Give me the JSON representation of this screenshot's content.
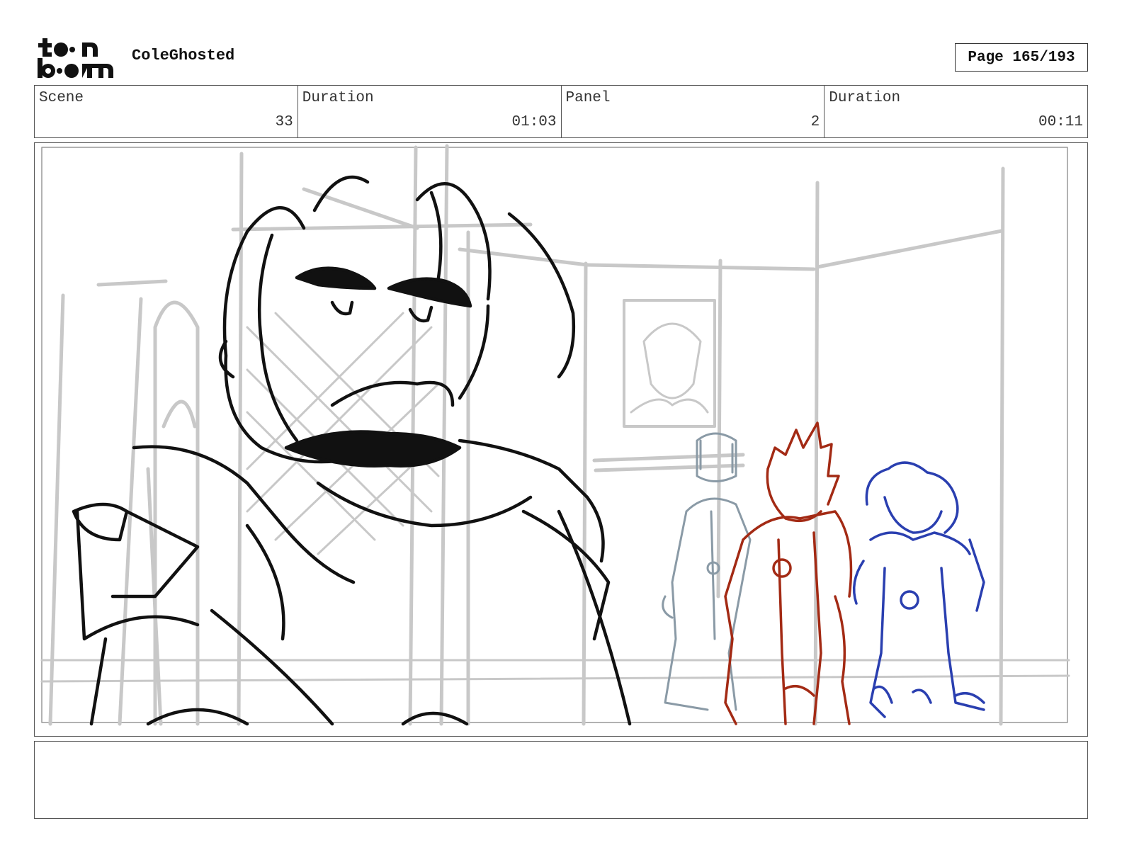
{
  "header": {
    "logo_text_top": "toon",
    "logo_text_bottom": "boom",
    "project_title": "ColeGhosted",
    "page_indicator": "Page 165/193"
  },
  "info": {
    "scene_label": "Scene",
    "scene_value": "33",
    "scene_duration_label": "Duration",
    "scene_duration_value": "01:03",
    "panel_label": "Panel",
    "panel_value": "2",
    "panel_duration_label": "Duration",
    "panel_duration_value": "00:11"
  },
  "panel": {
    "line_colors": {
      "background": "#c8c8c8",
      "main_character": "#111111",
      "left_character": "#8a9aa6",
      "middle_character": "#a32a14",
      "right_character": "#2a3fb0"
    }
  },
  "notes": {
    "text": ""
  }
}
